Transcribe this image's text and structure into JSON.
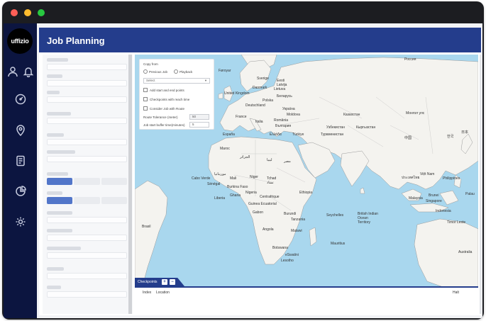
{
  "app": {
    "logo_text": "uffizio",
    "page_title": "Job Planning"
  },
  "sidebar": {
    "icons": [
      "user-icon",
      "bell-icon",
      "speedometer-icon",
      "location-pin-icon",
      "document-icon",
      "pie-chart-icon",
      "gear-icon"
    ]
  },
  "copy_from": {
    "title": "Copy from",
    "radio_previous_job": "Previous Job",
    "radio_playback": "Playback",
    "select_value": "Select",
    "checkbox_start_end": "Add start and end points",
    "checkbox_checkpoints_reach": "Checkpoints with reach time",
    "checkbox_consider_route": "Consider Job with Route",
    "route_tolerance_label": "Route Tolerance (meter)",
    "route_tolerance_value": "50",
    "buffer_time_label": "Job start buffer time(minutes)",
    "buffer_time_value": "5"
  },
  "checkpoints": {
    "tab_label": "Checkpoints",
    "add_symbol": "+",
    "remove_symbol": "−",
    "columns": [
      "Index",
      "Location",
      "Halt"
    ]
  },
  "map_labels": [
    "Føroyar",
    "Sverige",
    "Eesti",
    "Latvija",
    "Lietuva",
    "Danmark",
    "Беларусь",
    "United Kingdom",
    "Polska",
    "Deutschland",
    "Україна",
    "France",
    "Moldova",
    "Italia",
    "România",
    "България",
    "España",
    "Ελλάδα",
    "Türkiye",
    "Казахстан",
    "Монгол улс",
    "Узбекистан",
    "Туркменистан",
    "Кыргызстан",
    "Maroc",
    "الجزائر",
    "ليبيا",
    "مصر",
    "Niger",
    "Mali",
    "Tchad",
    "تشاد",
    "Cabo Verde",
    "Sénégal",
    "موريتانيا",
    "Burkina Faso",
    "Nigeria",
    "Ethiopia",
    "Ghana",
    "Liberia",
    "Centrafrique",
    "Gabon",
    "Guinea Ecuatorial",
    "Burundi",
    "Tanzania",
    "Angola",
    "Malawi",
    "Seychelles",
    "British Indian Ocean Territory",
    "Mauritius",
    "Botswana",
    "eSwatini",
    "Lesotho",
    "Brasil",
    "Россия",
    "中国",
    "한국",
    "日本",
    "ประเทศไทย",
    "Việt Nam",
    "Philippines",
    "Malaysia",
    "Singapore",
    "Indonesia",
    "Timor Leste",
    "Australia",
    "Palau",
    "Brunei"
  ],
  "colors": {
    "header": "#243d8c",
    "sidebar": "#0c1540",
    "water": "#a9d7ee",
    "land": "#f4f3ef"
  }
}
